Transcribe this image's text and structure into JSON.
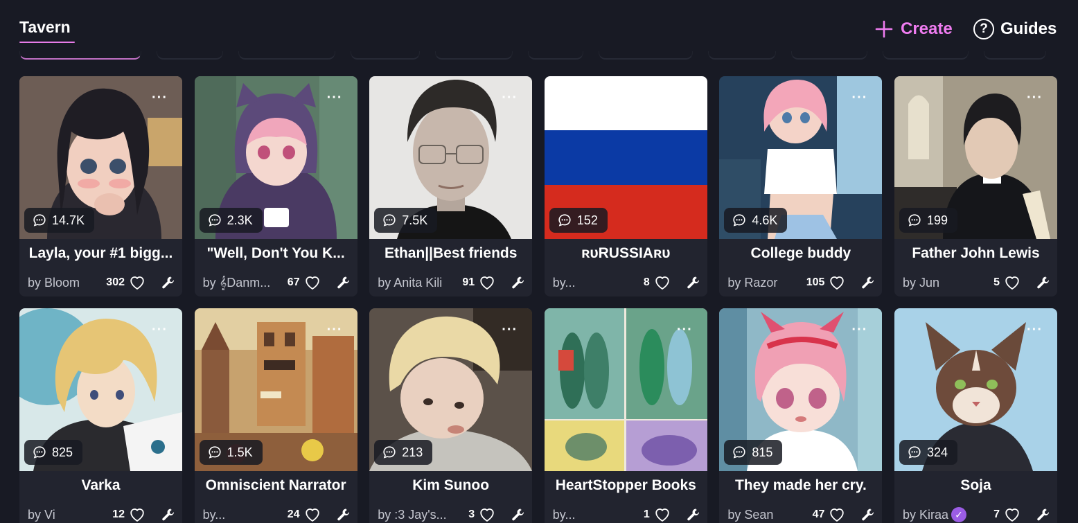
{
  "header": {
    "tab_label": "Tavern",
    "create_label": "Create",
    "guides_label": "Guides",
    "guides_glyph": "?"
  },
  "colors": {
    "accent": "#ef7cf0",
    "background": "#181a24",
    "card": "#22242f"
  },
  "cards": [
    {
      "title": "Layla, your #1 bigg...",
      "author": "by Bloom",
      "likes": "302",
      "chats": "14.7K",
      "image": "anime-girl-dark-hair"
    },
    {
      "title": "\"Well, Don't You K...",
      "author": "by 𝄞Danm...",
      "likes": "67",
      "chats": "2.3K",
      "image": "anime-girl-cat-hoodie"
    },
    {
      "title": "Ethan||Best friends",
      "author": "by Anita Kili",
      "likes": "91",
      "chats": "7.5K",
      "image": "man-with-glasses"
    },
    {
      "title": "ʀᴜRUSSIAʀᴜ",
      "author": "by...",
      "likes": "8",
      "chats": "152",
      "image": "russian-flag"
    },
    {
      "title": "College buddy",
      "author": "by Razor",
      "likes": "105",
      "chats": "4.6K",
      "image": "anime-girl-pink-hair"
    },
    {
      "title": "Father John Lewis",
      "author": "by Jun",
      "likes": "5",
      "chats": "199",
      "image": "priest-in-church"
    },
    {
      "title": "Varka",
      "author": "by Vi",
      "likes": "12",
      "chats": "825",
      "image": "anime-man-blonde"
    },
    {
      "title": "Omniscient Narrator",
      "author": "by...",
      "likes": "24",
      "chats": "1.5K",
      "image": "town-street-painting"
    },
    {
      "title": "Kim Sunoo",
      "author": "by :3 Jay's...",
      "likes": "3",
      "chats": "213",
      "image": "blonde-boy-photo"
    },
    {
      "title": "HeartStopper Books",
      "author": "by...",
      "likes": "1",
      "chats": "",
      "image": "book-covers-collage"
    },
    {
      "title": "They made her cry.",
      "author": "by Sean",
      "likes": "47",
      "chats": "815",
      "image": "anime-girl-crying"
    },
    {
      "title": "Soja",
      "author": "by Kiraa",
      "likes": "7",
      "chats": "324",
      "image": "lynx-character",
      "verified": true
    }
  ],
  "icons": {
    "more": "more-dots-icon",
    "chat": "chat-bubble-icon",
    "heart": "heart-icon",
    "wrench": "wrench-icon",
    "plus": "plus-icon",
    "help": "help-circle-icon"
  }
}
